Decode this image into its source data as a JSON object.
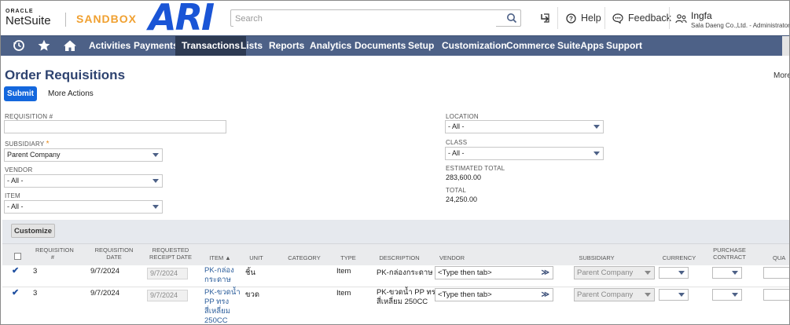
{
  "header": {
    "oracle": "ORACLE",
    "netsuite": "NetSuite",
    "sandbox": "SANDBOX",
    "logo_text": "ARI",
    "search_placeholder": "Search",
    "help": "Help",
    "feedback": "Feedback",
    "user_name": "Ingfa",
    "user_role": "Sala Daeng Co.,Ltd. - Administrator",
    "colors": {
      "sandbox": "#f0a030",
      "logo": "#1a55d6"
    }
  },
  "nav": {
    "icons": [
      "recent-icon",
      "star-icon",
      "home-icon"
    ],
    "items": [
      "Activities",
      "Payments",
      "Transactions",
      "Lists",
      "Reports",
      "Analytics",
      "Documents",
      "Setup",
      "Customization",
      "Commerce",
      "SuiteApps",
      "Support"
    ],
    "active": "Transactions",
    "colors": {
      "bar": "#4d6187",
      "active": "#2d3a52"
    }
  },
  "page": {
    "title": "Order Requisitions",
    "more": "More",
    "submit": "Submit",
    "more_actions": "More Actions"
  },
  "filters": {
    "requisition_label": "REQUISITION #",
    "requisition_value": "",
    "subsidiary_label": "SUBSIDIARY",
    "subsidiary_required": "*",
    "subsidiary_value": "Parent Company",
    "vendor_label": "VENDOR",
    "vendor_value": "- All -",
    "item_label": "ITEM",
    "item_value": "- All -",
    "location_label": "LOCATION",
    "location_value": "- All -",
    "class_label": "CLASS",
    "class_value": "- All -",
    "est_total_label": "ESTIMATED TOTAL",
    "est_total_value": "283,600.00",
    "total_label": "TOTAL",
    "total_value": "24,250.00"
  },
  "table": {
    "customize": "Customize",
    "columns": {
      "req_no": "REQUISITION #",
      "req_date": "REQUISITION DATE",
      "receipt_date": "REQUESTED RECEIPT DATE",
      "item": "ITEM ▲",
      "unit": "UNIT",
      "category": "CATEGORY",
      "type": "TYPE",
      "description": "DESCRIPTION",
      "vendor": "VENDOR",
      "subsidiary": "SUBSIDIARY",
      "currency": "CURRENCY",
      "purchase_contract": "PURCHASE CONTRACT",
      "quantity": "QUA"
    },
    "rows": [
      {
        "checked": true,
        "req_no": "3",
        "req_date": "9/7/2024",
        "receipt_date": "9/7/2024",
        "item_line1": "PK-กล่อง",
        "item_line2": "กระดาษ",
        "item_line3": "",
        "unit": "ชิ้น",
        "type": "Item",
        "description_line1": "PK-กล่องกระดาษ",
        "description_line2": "",
        "vendor": "<Type then tab>",
        "subsidiary": "Parent Company"
      },
      {
        "checked": true,
        "req_no": "3",
        "req_date": "9/7/2024",
        "receipt_date": "9/7/2024",
        "item_line1": "PK-ขวดน้ำ",
        "item_line2": "PP ทรง",
        "item_line3": "สี่เหลี่ยม",
        "item_line4": "250CC",
        "unit": "ขวด",
        "type": "Item",
        "description_line1": "PK-ขวดน้ำ PP ทรง",
        "description_line2": "สี่เหลี่ยม 250CC",
        "vendor": "<Type then tab>",
        "subsidiary": "Parent Company"
      }
    ]
  }
}
